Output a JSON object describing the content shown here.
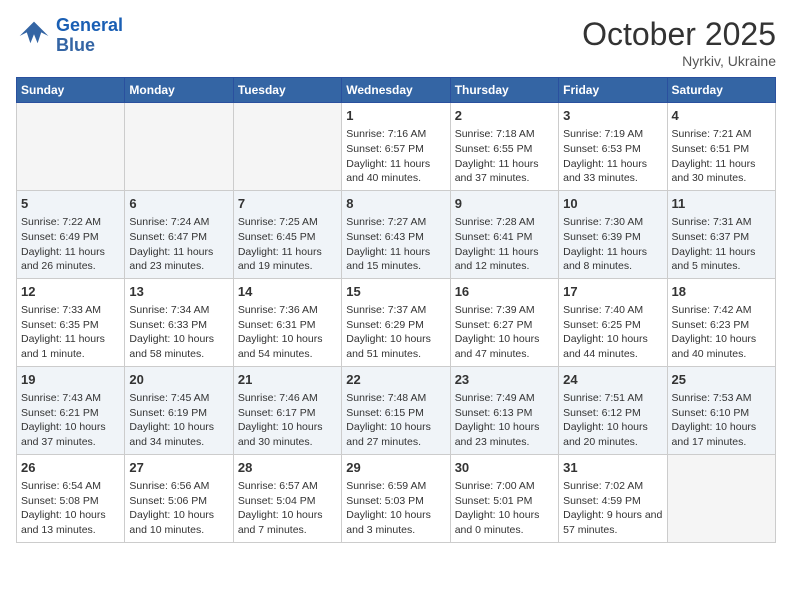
{
  "header": {
    "logo_general": "General",
    "logo_blue": "Blue",
    "month": "October 2025",
    "location": "Nyrkiv, Ukraine"
  },
  "weekdays": [
    "Sunday",
    "Monday",
    "Tuesday",
    "Wednesday",
    "Thursday",
    "Friday",
    "Saturday"
  ],
  "rows": [
    {
      "shaded": false,
      "cells": [
        {
          "day": "",
          "info": ""
        },
        {
          "day": "",
          "info": ""
        },
        {
          "day": "",
          "info": ""
        },
        {
          "day": "1",
          "info": "Sunrise: 7:16 AM\nSunset: 6:57 PM\nDaylight: 11 hours and 40 minutes."
        },
        {
          "day": "2",
          "info": "Sunrise: 7:18 AM\nSunset: 6:55 PM\nDaylight: 11 hours and 37 minutes."
        },
        {
          "day": "3",
          "info": "Sunrise: 7:19 AM\nSunset: 6:53 PM\nDaylight: 11 hours and 33 minutes."
        },
        {
          "day": "4",
          "info": "Sunrise: 7:21 AM\nSunset: 6:51 PM\nDaylight: 11 hours and 30 minutes."
        }
      ]
    },
    {
      "shaded": true,
      "cells": [
        {
          "day": "5",
          "info": "Sunrise: 7:22 AM\nSunset: 6:49 PM\nDaylight: 11 hours and 26 minutes."
        },
        {
          "day": "6",
          "info": "Sunrise: 7:24 AM\nSunset: 6:47 PM\nDaylight: 11 hours and 23 minutes."
        },
        {
          "day": "7",
          "info": "Sunrise: 7:25 AM\nSunset: 6:45 PM\nDaylight: 11 hours and 19 minutes."
        },
        {
          "day": "8",
          "info": "Sunrise: 7:27 AM\nSunset: 6:43 PM\nDaylight: 11 hours and 15 minutes."
        },
        {
          "day": "9",
          "info": "Sunrise: 7:28 AM\nSunset: 6:41 PM\nDaylight: 11 hours and 12 minutes."
        },
        {
          "day": "10",
          "info": "Sunrise: 7:30 AM\nSunset: 6:39 PM\nDaylight: 11 hours and 8 minutes."
        },
        {
          "day": "11",
          "info": "Sunrise: 7:31 AM\nSunset: 6:37 PM\nDaylight: 11 hours and 5 minutes."
        }
      ]
    },
    {
      "shaded": false,
      "cells": [
        {
          "day": "12",
          "info": "Sunrise: 7:33 AM\nSunset: 6:35 PM\nDaylight: 11 hours and 1 minute."
        },
        {
          "day": "13",
          "info": "Sunrise: 7:34 AM\nSunset: 6:33 PM\nDaylight: 10 hours and 58 minutes."
        },
        {
          "day": "14",
          "info": "Sunrise: 7:36 AM\nSunset: 6:31 PM\nDaylight: 10 hours and 54 minutes."
        },
        {
          "day": "15",
          "info": "Sunrise: 7:37 AM\nSunset: 6:29 PM\nDaylight: 10 hours and 51 minutes."
        },
        {
          "day": "16",
          "info": "Sunrise: 7:39 AM\nSunset: 6:27 PM\nDaylight: 10 hours and 47 minutes."
        },
        {
          "day": "17",
          "info": "Sunrise: 7:40 AM\nSunset: 6:25 PM\nDaylight: 10 hours and 44 minutes."
        },
        {
          "day": "18",
          "info": "Sunrise: 7:42 AM\nSunset: 6:23 PM\nDaylight: 10 hours and 40 minutes."
        }
      ]
    },
    {
      "shaded": true,
      "cells": [
        {
          "day": "19",
          "info": "Sunrise: 7:43 AM\nSunset: 6:21 PM\nDaylight: 10 hours and 37 minutes."
        },
        {
          "day": "20",
          "info": "Sunrise: 7:45 AM\nSunset: 6:19 PM\nDaylight: 10 hours and 34 minutes."
        },
        {
          "day": "21",
          "info": "Sunrise: 7:46 AM\nSunset: 6:17 PM\nDaylight: 10 hours and 30 minutes."
        },
        {
          "day": "22",
          "info": "Sunrise: 7:48 AM\nSunset: 6:15 PM\nDaylight: 10 hours and 27 minutes."
        },
        {
          "day": "23",
          "info": "Sunrise: 7:49 AM\nSunset: 6:13 PM\nDaylight: 10 hours and 23 minutes."
        },
        {
          "day": "24",
          "info": "Sunrise: 7:51 AM\nSunset: 6:12 PM\nDaylight: 10 hours and 20 minutes."
        },
        {
          "day": "25",
          "info": "Sunrise: 7:53 AM\nSunset: 6:10 PM\nDaylight: 10 hours and 17 minutes."
        }
      ]
    },
    {
      "shaded": false,
      "cells": [
        {
          "day": "26",
          "info": "Sunrise: 6:54 AM\nSunset: 5:08 PM\nDaylight: 10 hours and 13 minutes."
        },
        {
          "day": "27",
          "info": "Sunrise: 6:56 AM\nSunset: 5:06 PM\nDaylight: 10 hours and 10 minutes."
        },
        {
          "day": "28",
          "info": "Sunrise: 6:57 AM\nSunset: 5:04 PM\nDaylight: 10 hours and 7 minutes."
        },
        {
          "day": "29",
          "info": "Sunrise: 6:59 AM\nSunset: 5:03 PM\nDaylight: 10 hours and 3 minutes."
        },
        {
          "day": "30",
          "info": "Sunrise: 7:00 AM\nSunset: 5:01 PM\nDaylight: 10 hours and 0 minutes."
        },
        {
          "day": "31",
          "info": "Sunrise: 7:02 AM\nSunset: 4:59 PM\nDaylight: 9 hours and 57 minutes."
        },
        {
          "day": "",
          "info": ""
        }
      ]
    }
  ]
}
